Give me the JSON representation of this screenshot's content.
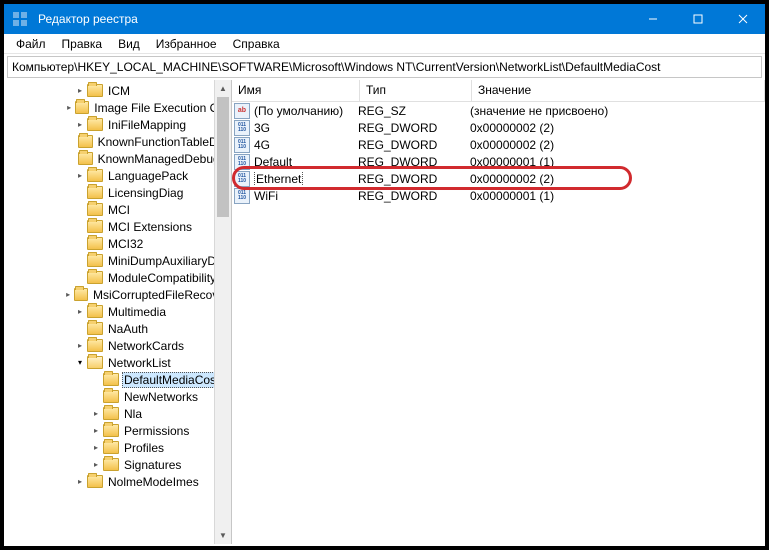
{
  "window": {
    "title": "Редактор реестра"
  },
  "menu": [
    "Файл",
    "Правка",
    "Вид",
    "Избранное",
    "Справка"
  ],
  "path": "Компьютер\\HKEY_LOCAL_MACHINE\\SOFTWARE\\Microsoft\\Windows NT\\CurrentVersion\\NetworkList\\DefaultMediaCost",
  "columns": {
    "name": "Имя",
    "type": "Тип",
    "value": "Значение"
  },
  "tree": [
    {
      "label": "ICM",
      "depth": 3,
      "twisty": ">"
    },
    {
      "label": "Image File Execution Opt",
      "depth": 3,
      "twisty": ">"
    },
    {
      "label": "IniFileMapping",
      "depth": 3,
      "twisty": ">"
    },
    {
      "label": "KnownFunctionTableDlls",
      "depth": 3,
      "twisty": ""
    },
    {
      "label": "KnownManagedDebuggi",
      "depth": 3,
      "twisty": ""
    },
    {
      "label": "LanguagePack",
      "depth": 3,
      "twisty": ">"
    },
    {
      "label": "LicensingDiag",
      "depth": 3,
      "twisty": ""
    },
    {
      "label": "MCI",
      "depth": 3,
      "twisty": ""
    },
    {
      "label": "MCI Extensions",
      "depth": 3,
      "twisty": ""
    },
    {
      "label": "MCI32",
      "depth": 3,
      "twisty": ""
    },
    {
      "label": "MiniDumpAuxiliaryDlls",
      "depth": 3,
      "twisty": ""
    },
    {
      "label": "ModuleCompatibility",
      "depth": 3,
      "twisty": ""
    },
    {
      "label": "MsiCorruptedFileRecover",
      "depth": 3,
      "twisty": ">"
    },
    {
      "label": "Multimedia",
      "depth": 3,
      "twisty": ">"
    },
    {
      "label": "NaAuth",
      "depth": 3,
      "twisty": ""
    },
    {
      "label": "NetworkCards",
      "depth": 3,
      "twisty": ">"
    },
    {
      "label": "NetworkList",
      "depth": 3,
      "twisty": "v"
    },
    {
      "label": "DefaultMediaCost",
      "depth": 4,
      "twisty": "",
      "selected": true
    },
    {
      "label": "NewNetworks",
      "depth": 4,
      "twisty": ""
    },
    {
      "label": "Nla",
      "depth": 4,
      "twisty": ">"
    },
    {
      "label": "Permissions",
      "depth": 4,
      "twisty": ">"
    },
    {
      "label": "Profiles",
      "depth": 4,
      "twisty": ">"
    },
    {
      "label": "Signatures",
      "depth": 4,
      "twisty": ">"
    },
    {
      "label": "NolmeModeImes",
      "depth": 3,
      "twisty": ">"
    }
  ],
  "values": [
    {
      "icon": "ab",
      "name": "(По умолчанию)",
      "type": "REG_SZ",
      "value": "(значение не присвоено)"
    },
    {
      "icon": "bin",
      "name": "3G",
      "type": "REG_DWORD",
      "value": "0x00000002 (2)"
    },
    {
      "icon": "bin",
      "name": "4G",
      "type": "REG_DWORD",
      "value": "0x00000002 (2)"
    },
    {
      "icon": "bin",
      "name": "Default",
      "type": "REG_DWORD",
      "value": "0x00000001 (1)"
    },
    {
      "icon": "bin",
      "name": "Ethernet",
      "type": "REG_DWORD",
      "value": "0x00000002 (2)",
      "highlighted": true
    },
    {
      "icon": "bin",
      "name": "WiFi",
      "type": "REG_DWORD",
      "value": "0x00000001 (1)"
    }
  ],
  "icon_labels": {
    "ab": "ab",
    "bin": "011\n110"
  }
}
